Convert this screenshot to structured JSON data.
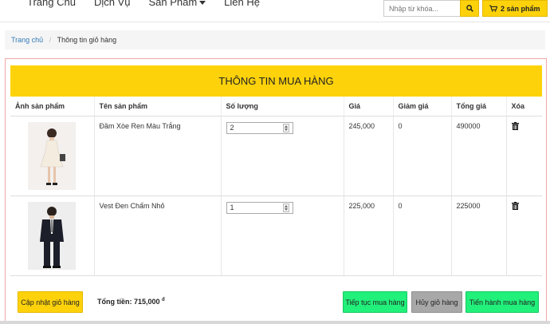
{
  "nav": {
    "items": [
      "Trang Chủ",
      "Dịch Vụ",
      "Sản Phẩm",
      "Liên Hệ"
    ],
    "search_placeholder": "Nhập từ khóa...",
    "cart_label": "2 sản phẩm"
  },
  "breadcrumb": {
    "home": "Trang chủ",
    "sep": "/",
    "current": "Thông tin giỏ hàng"
  },
  "cart": {
    "title": "THÔNG TIN MUA HÀNG",
    "columns": [
      "Ảnh sản phẩm",
      "Tên sản phẩm",
      "Số lượng",
      "Giá",
      "Giảm giá",
      "Tổng giá",
      "Xóa"
    ],
    "rows": [
      {
        "name": "Đầm Xòe Ren Màu Trắng",
        "qty": "2",
        "price": "245,000",
        "discount": "0",
        "total": "490000"
      },
      {
        "name": "Vest Đen Chấm Nhỏ",
        "qty": "1",
        "price": "225,000",
        "discount": "0",
        "total": "225000"
      }
    ],
    "update_label": "Cập nhật giỏ hàng",
    "total_label": "Tổng tiền: 715,000",
    "currency": "đ",
    "continue_label": "Tiếp tục mua hàng",
    "cancel_label": "Hủy giỏ hàng",
    "checkout_label": "Tiến hành mua hàng"
  },
  "colors": {
    "accent_yellow": "#fdd20b",
    "action_green": "#21f07a",
    "cancel_gray": "#a8a8a8",
    "panel_border": "#f2a7a7"
  }
}
